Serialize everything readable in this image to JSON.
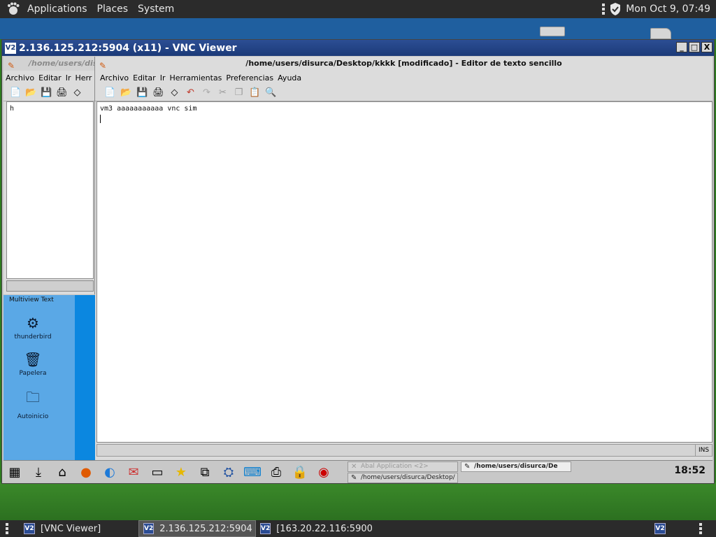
{
  "top_panel": {
    "menus": [
      "Applications",
      "Places",
      "System"
    ],
    "clock": "Mon Oct  9, 07:49"
  },
  "vnc_window": {
    "title": "2.136.125.212:5904 (x11) - VNC Viewer",
    "logo": "V2",
    "controls": {
      "minimize": "_",
      "maximize": "□",
      "close": "X"
    }
  },
  "left_editor": {
    "title": "/home/users/disu",
    "menus": [
      {
        "label": "Archivo"
      },
      {
        "label": "Editar"
      },
      {
        "label": "Ir"
      },
      {
        "label": "Herr"
      }
    ],
    "content": "h"
  },
  "multiview": {
    "title": "Multiview Text",
    "icons": [
      {
        "label": "thunderbird",
        "icon": "thunderbird-icon"
      },
      {
        "label": "Papelera",
        "icon": "trash-icon"
      },
      {
        "label": "Autoinicio",
        "icon": "folder-icon"
      }
    ]
  },
  "main_editor": {
    "title": "/home/users/disurca/Desktop/kkkk [modificado] - Editor de texto sencillo",
    "menus": [
      "Archivo",
      "Editar",
      "Ir",
      "Herramientas",
      "Preferencias",
      "Ayuda"
    ],
    "content": "vm3 aaaaaaaaaaa vnc sim",
    "status_mode": "INS"
  },
  "remote_taskbar": {
    "tasks": [
      {
        "label": "Abal Application <2>",
        "state": "inactive"
      },
      {
        "label": "/home/users/disurca/De",
        "state": "active"
      },
      {
        "label": "/home/users/disurca/Desktop/",
        "state": "inactive"
      }
    ],
    "clock": "18:52"
  },
  "host_taskbar": {
    "items": [
      {
        "label": "[VNC Viewer]"
      },
      {
        "label": "2.136.125.212:5904 (…"
      },
      {
        "label": "[163.20.22.116:5900 …"
      }
    ],
    "tray_logo": "V2"
  },
  "colors": {
    "panel_bg": "#2b2b2b",
    "vnc_title_bg": "#1c3a78",
    "multiview_bg": "#5aa8e6",
    "wallpaper_green": "#2d7a1e"
  }
}
